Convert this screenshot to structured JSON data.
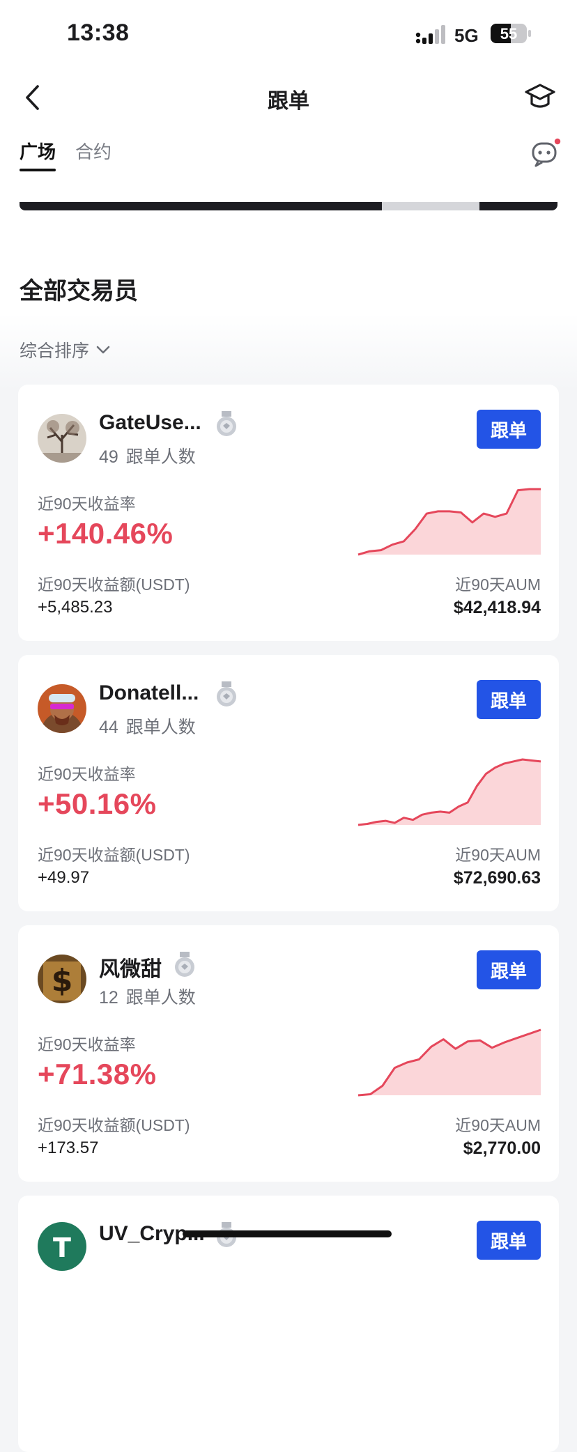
{
  "status_bar": {
    "time": "13:38",
    "network": "5G",
    "battery": "55",
    "battery_level": 0.55
  },
  "header": {
    "title": "跟单",
    "back_icon": "chevron-left-icon",
    "right_icon": "graduation-cap-icon"
  },
  "tabs": [
    {
      "label": "广场",
      "active": true
    },
    {
      "label": "合约",
      "active": false
    }
  ],
  "section": {
    "title": "全部交易员",
    "sort_label": "综合排序"
  },
  "colors": {
    "primary": "#2354e6",
    "profit": "#e5475b",
    "chart_fill": "#fbd6d9"
  },
  "traders": [
    {
      "name": "GateUse...",
      "followers_count": "49",
      "followers_label": "跟单人数",
      "follow_button": "跟单",
      "roi_label": "近90天收益率",
      "roi": "+140.46%",
      "pnl_label": "近90天收益额(USDT)",
      "pnl": "+5,485.23",
      "aum_label": "近90天AUM",
      "aum": "$42,418.94",
      "trend": [
        5,
        8,
        9,
        14,
        17,
        28,
        42,
        44,
        44,
        43,
        34,
        42,
        39,
        42,
        63,
        64,
        64
      ]
    },
    {
      "name": "Donatell...",
      "followers_count": "44",
      "followers_label": "跟单人数",
      "follow_button": "跟单",
      "roi_label": "近90天收益率",
      "roi": "+50.16%",
      "pnl_label": "近90天收益额(USDT)",
      "pnl": "+49.97",
      "aum_label": "近90天AUM",
      "aum": "$72,690.63",
      "trend": [
        2,
        3,
        5,
        6,
        4,
        9,
        7,
        12,
        14,
        15,
        14,
        20,
        24,
        40,
        52,
        58,
        62,
        64,
        66,
        65,
        64
      ]
    },
    {
      "name": "风微甜",
      "followers_count": "12",
      "followers_label": "跟单人数",
      "follow_button": "跟单",
      "roi_label": "近90天收益率",
      "roi": "+71.38%",
      "pnl_label": "近90天收益额(USDT)",
      "pnl": "+173.57",
      "aum_label": "近90天AUM",
      "aum": "$2,770.00",
      "trend": [
        4,
        5,
        13,
        30,
        35,
        38,
        50,
        57,
        48,
        55,
        56,
        49,
        54,
        58,
        62,
        66
      ]
    },
    {
      "name": "UV_Cryp...",
      "follow_button": "跟单"
    }
  ]
}
